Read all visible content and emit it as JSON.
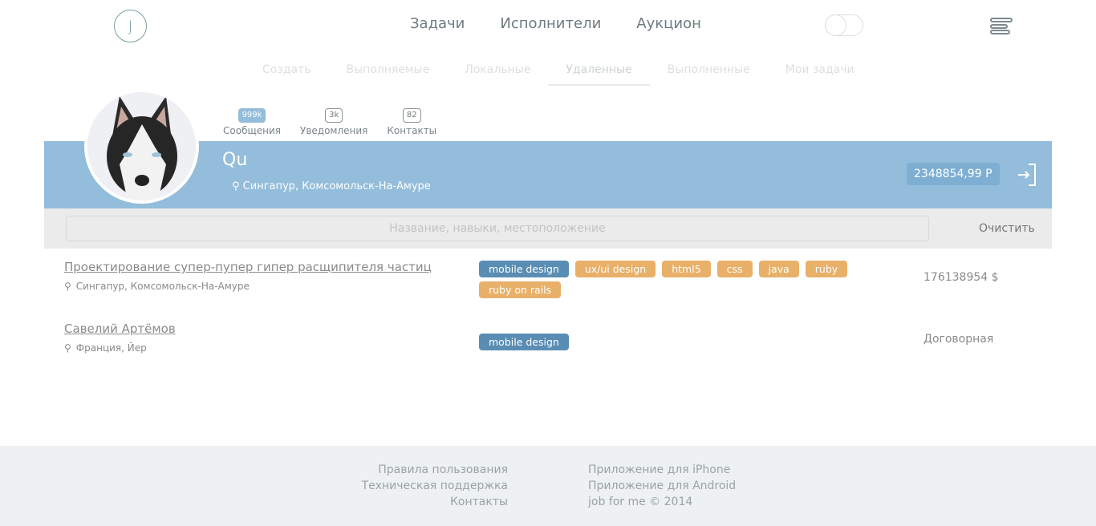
{
  "header": {
    "logo": "J",
    "nav": [
      "Задачи",
      "Исполнители",
      "Аукцион"
    ]
  },
  "subnav": {
    "items": [
      "Создать",
      "Выполняемые",
      "Локальные",
      "Удаленные",
      "Выполненные",
      "Мои задачи"
    ],
    "active": "Удаленные"
  },
  "profile": {
    "counters": [
      {
        "value": "999k",
        "label": "Сообщения"
      },
      {
        "value": "3k",
        "label": "Уведомления"
      },
      {
        "value": "82",
        "label": "Контакты"
      }
    ],
    "name": "Qu",
    "location": "Сингапур, Комсомольск-На-Амуре",
    "balance": "2348854,99 Р"
  },
  "search": {
    "placeholder": "Название, навыки, местоположение",
    "value": "",
    "clear": "Очистить"
  },
  "tasks": [
    {
      "title": "Проектирование супер-пупер гипер расщипителя частиц",
      "location": "Сингапур, Комсомольск-На-Амуре",
      "tags": [
        "mobile design",
        "ux/ui design",
        "html5",
        "css",
        "java",
        "ruby",
        "ruby on rails"
      ],
      "price": "176138954 $"
    },
    {
      "title": "Савелий Артёмов",
      "location": "Франция, Йер",
      "tags": [
        "mobile design"
      ],
      "price": "Договорная"
    }
  ],
  "footer": {
    "left": [
      "Правила пользования",
      "Техническая поддержка",
      "Контакты"
    ],
    "right": [
      "Приложение для iPhone",
      "Приложение для Android",
      "job for me © 2014"
    ]
  },
  "colors": {
    "band": "#93bddb",
    "tag": "#e8b069",
    "tag_primary": "#5a8db3"
  }
}
